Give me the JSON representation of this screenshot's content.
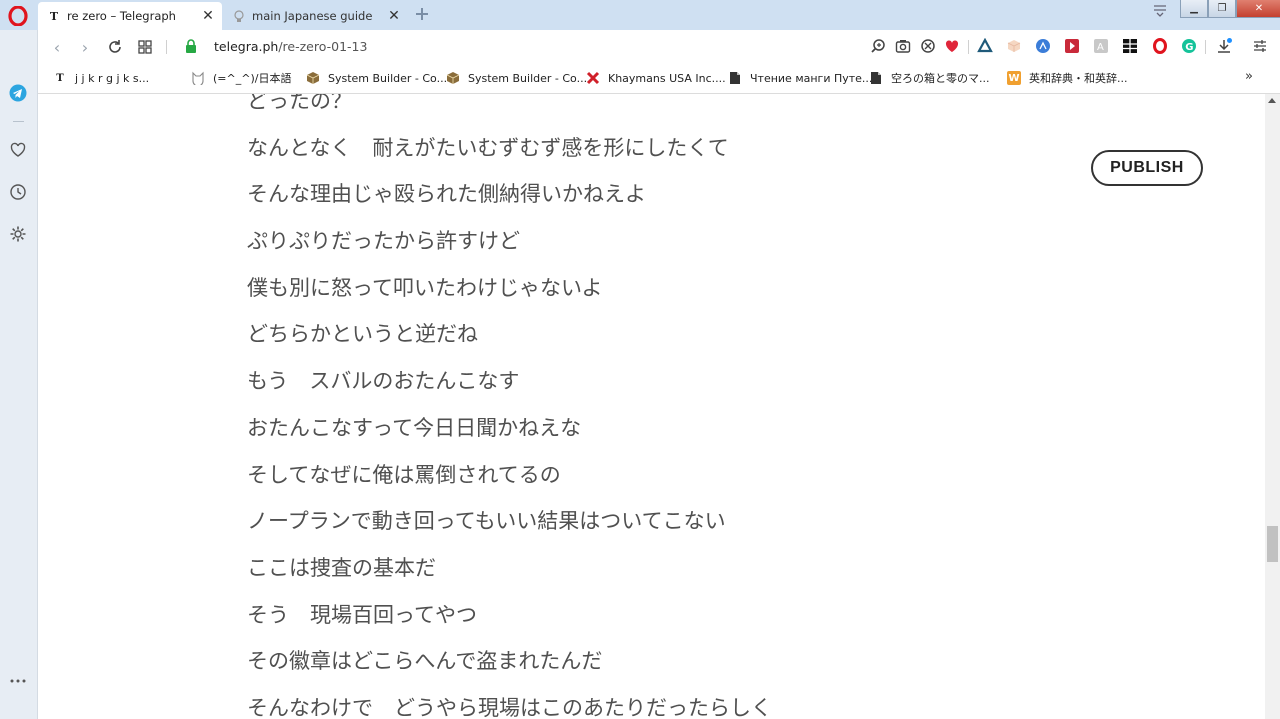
{
  "tabs": [
    {
      "label": "re zero – Telegraph",
      "favicon": "T",
      "active": true
    },
    {
      "label": "main Japanese guide",
      "favicon": "bulb-icon",
      "active": false
    }
  ],
  "address": {
    "domain": "telegra.ph",
    "path": "/re-zero-01-13"
  },
  "bookmarks": [
    {
      "label": "j j k r g j k s...",
      "icon": "T"
    },
    {
      "label": "(=^_^)/日本語",
      "icon": "cat-icon"
    },
    {
      "label": "System Builder - Co...",
      "icon": "box-icon"
    },
    {
      "label": "System Builder - Co...",
      "icon": "box-icon"
    },
    {
      "label": "Khaymans USA Inc....",
      "icon": "x-logo-icon"
    },
    {
      "label": "Чтение манги Путе...",
      "icon": "page-icon"
    },
    {
      "label": "空ろの箱と零のマ...",
      "icon": "page-icon"
    },
    {
      "label": "英和辞典・和英辞...",
      "icon": "W"
    }
  ],
  "publish_label": "PUBLISH",
  "lines": [
    "どったの？",
    "なんとなく　耐えがたいむずむず感を形にしたくて",
    "そんな理由じゃ殴られた側納得いかねえよ",
    "ぷりぷりだったから許すけど",
    "僕も別に怒って叩いたわけじゃないよ",
    "どちらかというと逆だね",
    "もう　スバルのおたんこなす",
    "おたんこなすって今日日聞かねえな",
    "そしてなぜに俺は罵倒されてるの",
    "ノープランで動き回ってもいい結果はついてこない",
    "ここは捜査の基本だ",
    "そう　現場百回ってやつ",
    "その徽章はどこらへんで盗まれたんだ",
    "そんなわけで　どうやら現場はこのあたりだったらしく"
  ],
  "colors": {
    "tabbar": "#cfe0f2",
    "sidebar": "#e7edf4",
    "text": "#505050",
    "opera_red": "#e0141e"
  }
}
